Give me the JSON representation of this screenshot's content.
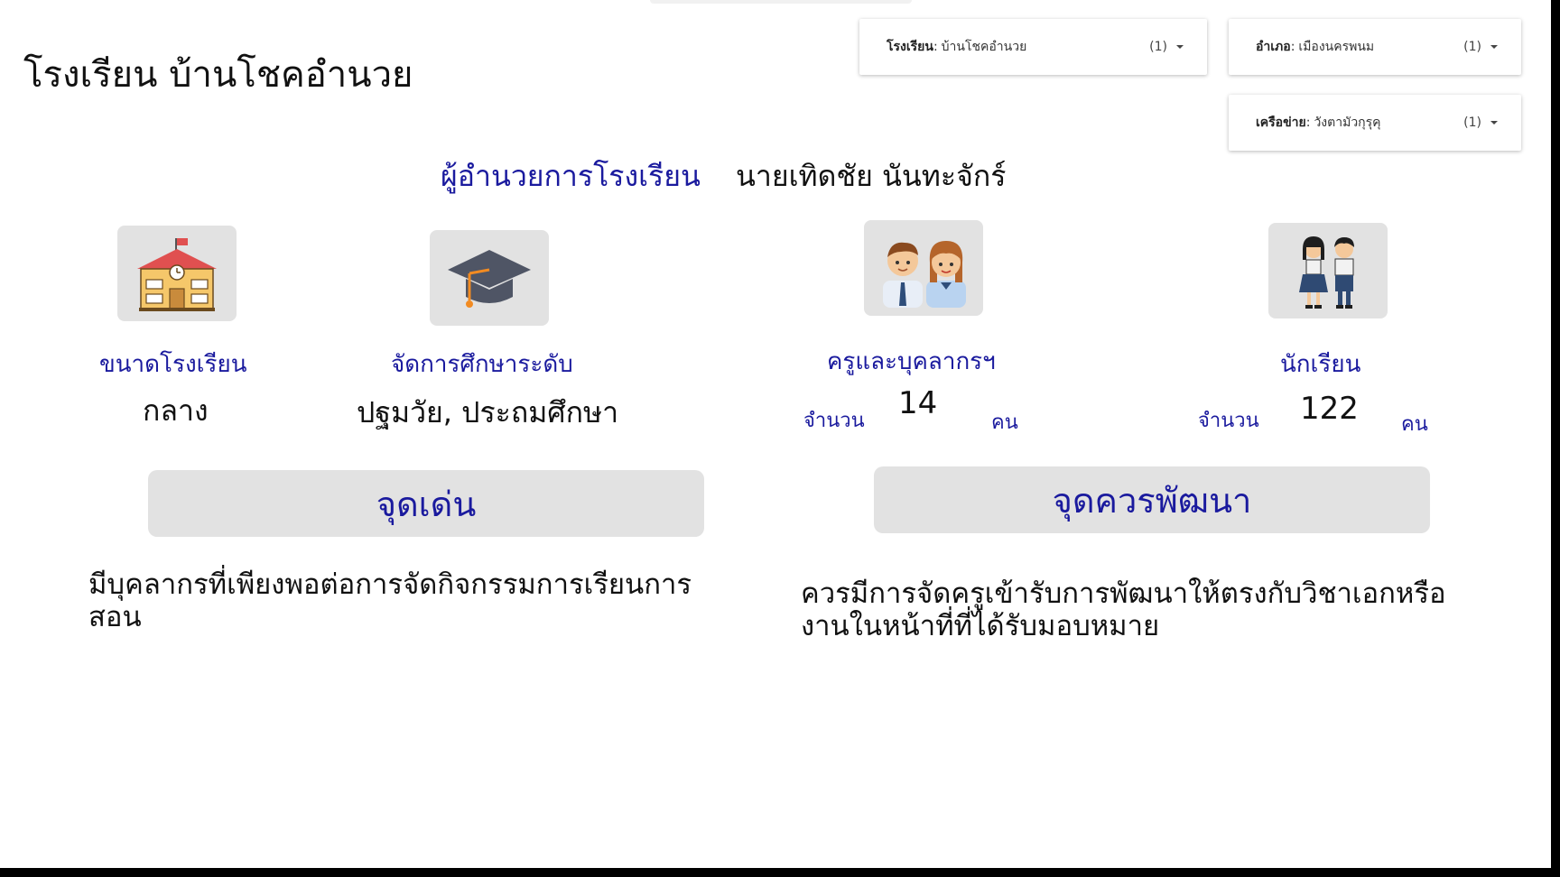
{
  "page": {
    "title": "โรงเรียน บ้านโชคอำนวย"
  },
  "filters": [
    {
      "label": "โรงเรียน",
      "value": "บ้านโชคอำนวย",
      "count": "(1)"
    },
    {
      "label": "อำเภอ",
      "value": "เมืองนครพนม",
      "count": "(1)"
    },
    {
      "label": "เครือข่าย",
      "value": "วังตามัวกุรุคุ",
      "count": "(1)"
    }
  ],
  "director": {
    "label": "ผู้อำนวยการโรงเรียน",
    "name": "นายเทิดชัย นันทะจักร์"
  },
  "size": {
    "label": "ขนาดโรงเรียน",
    "value": "กลาง"
  },
  "level": {
    "label": "จัดการศึกษาระดับ",
    "value": "ปฐมวัย, ประถมศึกษา"
  },
  "teachers": {
    "label": "ครูและบุคลากรฯ",
    "count_label": "จำนวน",
    "count": "14",
    "unit": "คน"
  },
  "students": {
    "label": "นักเรียน",
    "count_label": "จำนวน",
    "count": "122",
    "unit": "คน"
  },
  "strengths": {
    "title": "จุดเด่น",
    "line1": "มีบุคลากรที่เพียงพอต่อการจัดกิจกรรมการเรียนการ",
    "line2": "สอน"
  },
  "improvements": {
    "title": "จุดควรพัฒนา",
    "line1": "ควรมีการจัดครูเข้ารับการพัฒนาให้ตรงกับวิชาเอกหรือ",
    "line2": "งานในหน้าที่ที่ได้รับมอบหมาย"
  },
  "icons": {
    "school": "school-building-icon",
    "level": "graduation-cap-icon",
    "teachers": "teachers-icon",
    "students": "students-icon"
  }
}
